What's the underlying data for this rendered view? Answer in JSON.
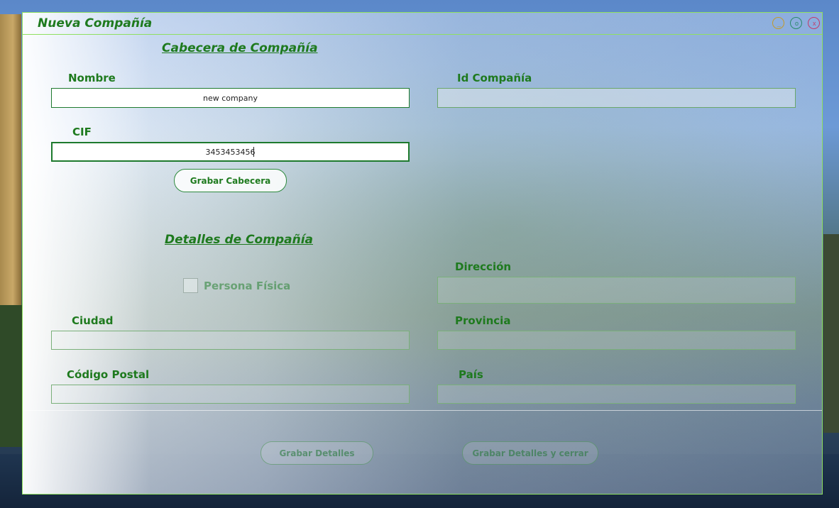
{
  "window": {
    "title": "Nueva Compañía",
    "controls": {
      "minimize": "_",
      "maximize": "o",
      "close": "x"
    }
  },
  "header_section": {
    "title": "Cabecera de Compañía",
    "nombre_label": "Nombre",
    "nombre_value": "new company",
    "id_label": "Id Compañía",
    "id_value": "",
    "cif_label": "CIF",
    "cif_value": "3453453456",
    "save_button": "Grabar Cabecera"
  },
  "details_section": {
    "title": "Detalles de Compañía",
    "persona_fisica_label": "Persona Física",
    "persona_fisica_checked": false,
    "direccion_label": "Dirección",
    "direccion_value": "",
    "ciudad_label": "Ciudad",
    "ciudad_value": "",
    "provincia_label": "Provincia",
    "provincia_value": "",
    "codigo_postal_label": "Código Postal",
    "codigo_postal_value": "",
    "pais_label": "País",
    "pais_value": "",
    "save_details_button": "Grabar Detalles",
    "save_close_button": "Grabar Detalles y cerrar"
  },
  "colors": {
    "accent": "#1e7a1e",
    "border": "#8fe060"
  }
}
